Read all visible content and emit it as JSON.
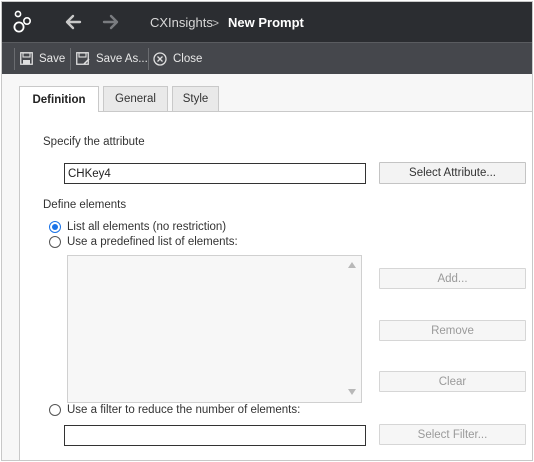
{
  "header": {
    "app_name": "CXInsights",
    "separator": ">",
    "page_title": "New Prompt"
  },
  "toolbar": {
    "save_label": "Save",
    "save_as_label": "Save As...",
    "close_label": "Close"
  },
  "tabs": [
    {
      "label": "Definition",
      "active": true
    },
    {
      "label": "General",
      "active": false
    },
    {
      "label": "Style",
      "active": false
    }
  ],
  "definition": {
    "specify_label": "Specify the attribute",
    "attribute_value": "CHKey4",
    "select_attribute_label": "Select Attribute...",
    "define_label": "Define elements",
    "options": [
      {
        "label": "List all elements (no restriction)",
        "checked": true
      },
      {
        "label": "Use a predefined list of elements:",
        "checked": false
      },
      {
        "label": "Use a filter to reduce the number of elements:",
        "checked": false
      }
    ],
    "add_label": "Add...",
    "remove_label": "Remove",
    "clear_label": "Clear",
    "filter_value": "",
    "select_filter_label": "Select Filter..."
  },
  "colors": {
    "titlebar_bg": "#2b2d31",
    "toolbar_bg": "#45474c",
    "radio_accent": "#1a73e8"
  },
  "icons": [
    "app-logo-icon",
    "back-arrow-icon",
    "forward-arrow-icon",
    "save-icon",
    "save-as-icon",
    "close-circle-icon"
  ]
}
